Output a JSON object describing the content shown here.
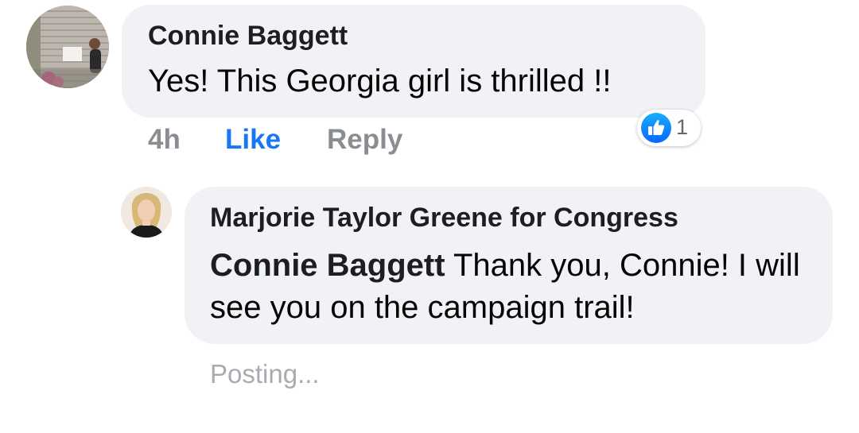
{
  "comment": {
    "author": "Connie Baggett",
    "text": "Yes! This Georgia girl is thrilled !!",
    "time": "4h",
    "like_label": "Like",
    "reply_label": "Reply",
    "reaction_icon": "like-thumbs-up-icon",
    "reaction_count": "1"
  },
  "reply": {
    "author": "Marjorie Taylor Greene for Congress",
    "mention": "Connie Baggett",
    "text": " Thank you, Connie! I will see you on the campaign trail!",
    "status": "Posting..."
  },
  "colors": {
    "bubble": "#f0f2f5",
    "like_blue": "#1877f2",
    "meta_gray": "#8a8d91"
  }
}
